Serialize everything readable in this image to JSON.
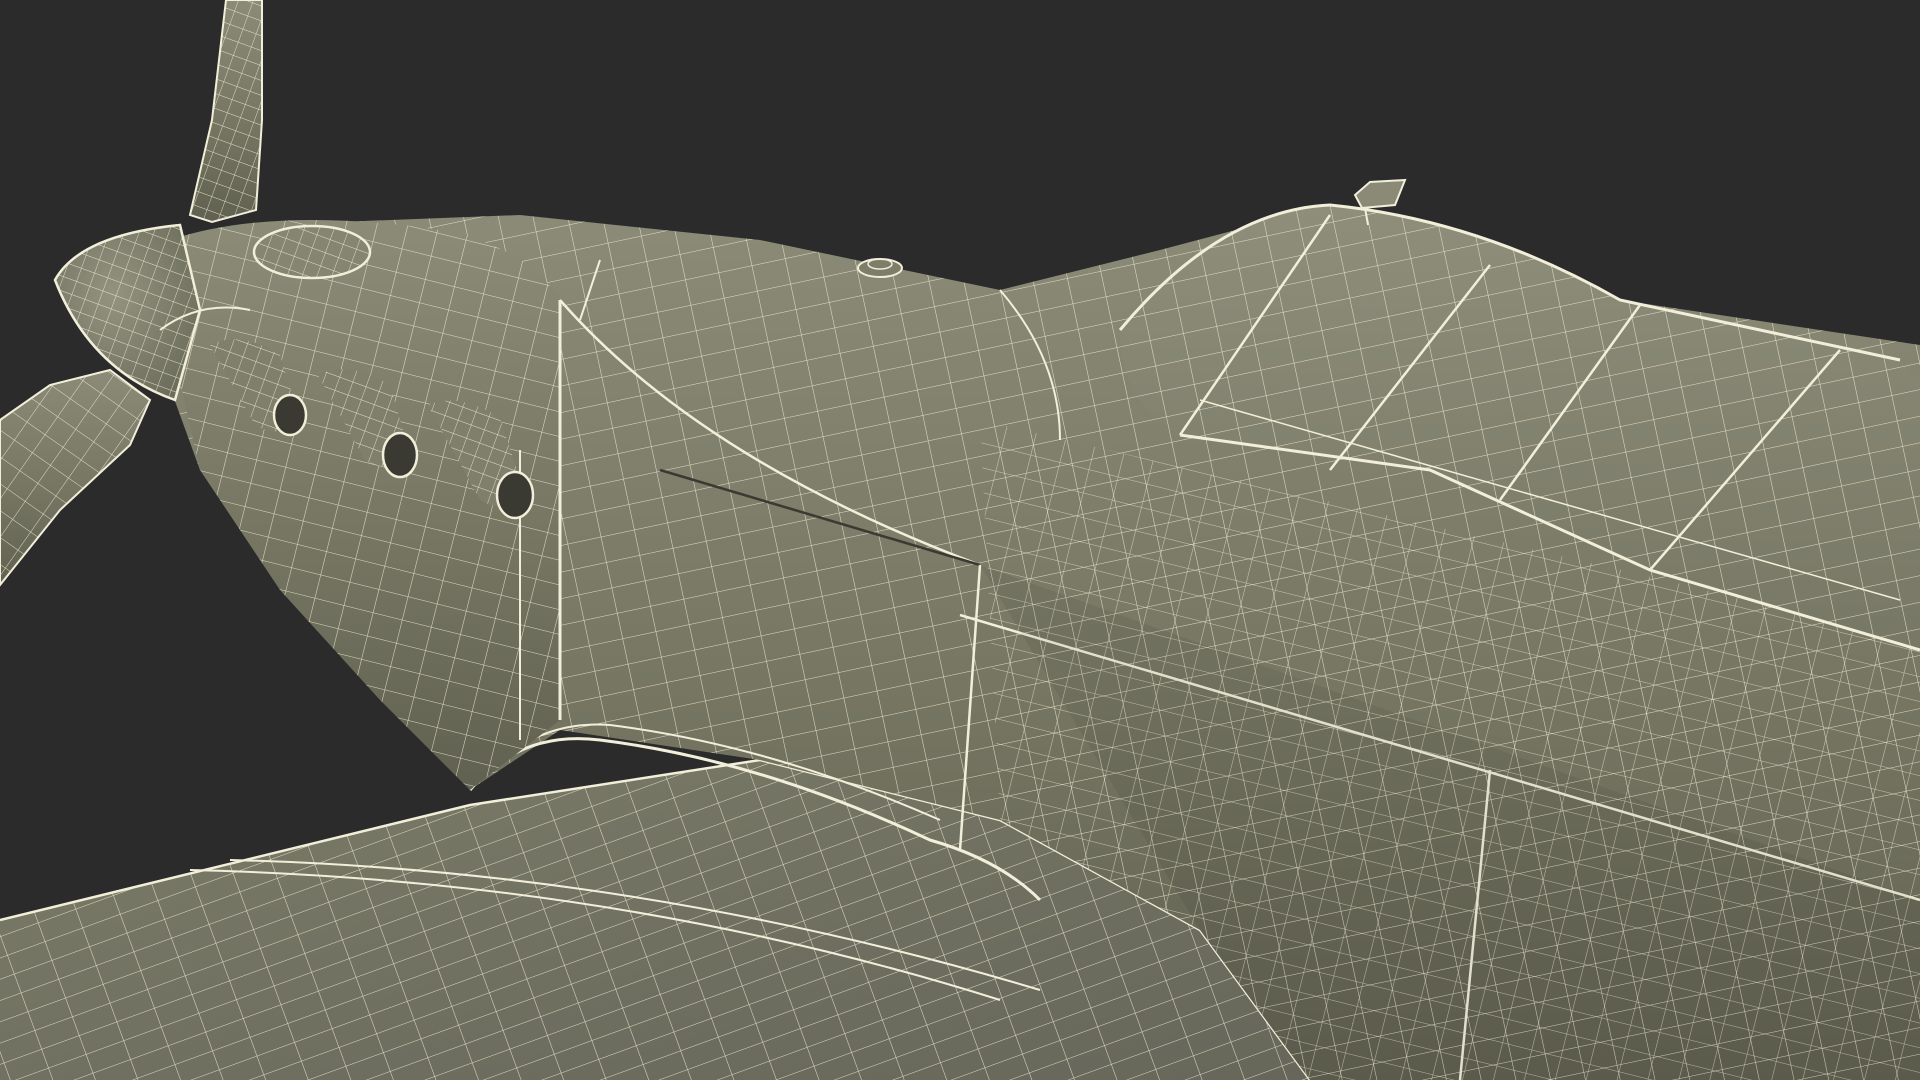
{
  "scene": {
    "subject": "aircraft-wireframe-render",
    "colors": {
      "background": "#2b2b2b",
      "surface_light": "#8a8a76",
      "surface_mid": "#787865",
      "surface_dark": "#5c5c4c",
      "wire": "#f1efd9"
    }
  }
}
